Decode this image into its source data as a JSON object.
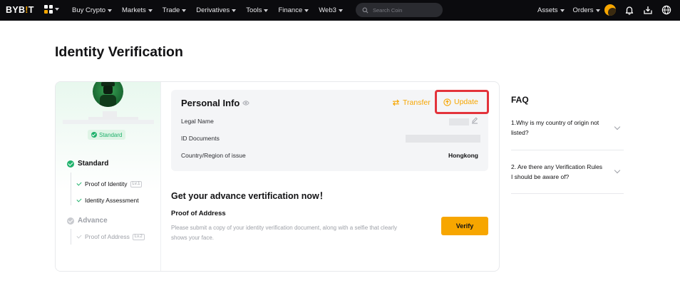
{
  "nav": {
    "logo_main": "BYB",
    "logo_accent": "!",
    "logo_end": "T",
    "items": [
      "Buy Crypto",
      "Markets",
      "Trade",
      "Derivatives",
      "Tools",
      "Finance",
      "Web3"
    ],
    "search_placeholder": "Search Coin",
    "right_items": [
      "Assets",
      "Orders"
    ]
  },
  "page": {
    "title": "Identity Verification"
  },
  "sidebar": {
    "badge": "Standard",
    "levels": [
      {
        "label": "Standard",
        "steps": [
          {
            "label": "Proof of Identity",
            "tag": "Lv.1"
          },
          {
            "label": "Identity Assessment",
            "tag": ""
          }
        ]
      },
      {
        "label": "Advance",
        "steps": [
          {
            "label": "Proof of Address",
            "tag": "Lv.2"
          }
        ]
      }
    ]
  },
  "personal_info": {
    "title": "Personal Info",
    "transfer_label": "Transfer",
    "update_label": "Update",
    "rows": [
      {
        "label": "Legal Name",
        "value": ""
      },
      {
        "label": "ID Documents",
        "value": ""
      },
      {
        "label": "Country/Region of issue",
        "value": "Hongkong"
      }
    ]
  },
  "advance": {
    "title": "Get your advance vertification now！",
    "poa_title": "Proof of Address",
    "poa_desc": "Please submit a copy of your identity verification document, along with a selfie that clearly shows your face.",
    "verify_label": "Verify"
  },
  "faq": {
    "title": "FAQ",
    "items": [
      {
        "q": "1.Why is my country of origin not listed?"
      },
      {
        "q": "2. Are there any Verification Rules I should be aware of?"
      }
    ]
  },
  "colors": {
    "accent": "#f7a600",
    "success": "#20b26c",
    "highlight": "#e3333b"
  }
}
